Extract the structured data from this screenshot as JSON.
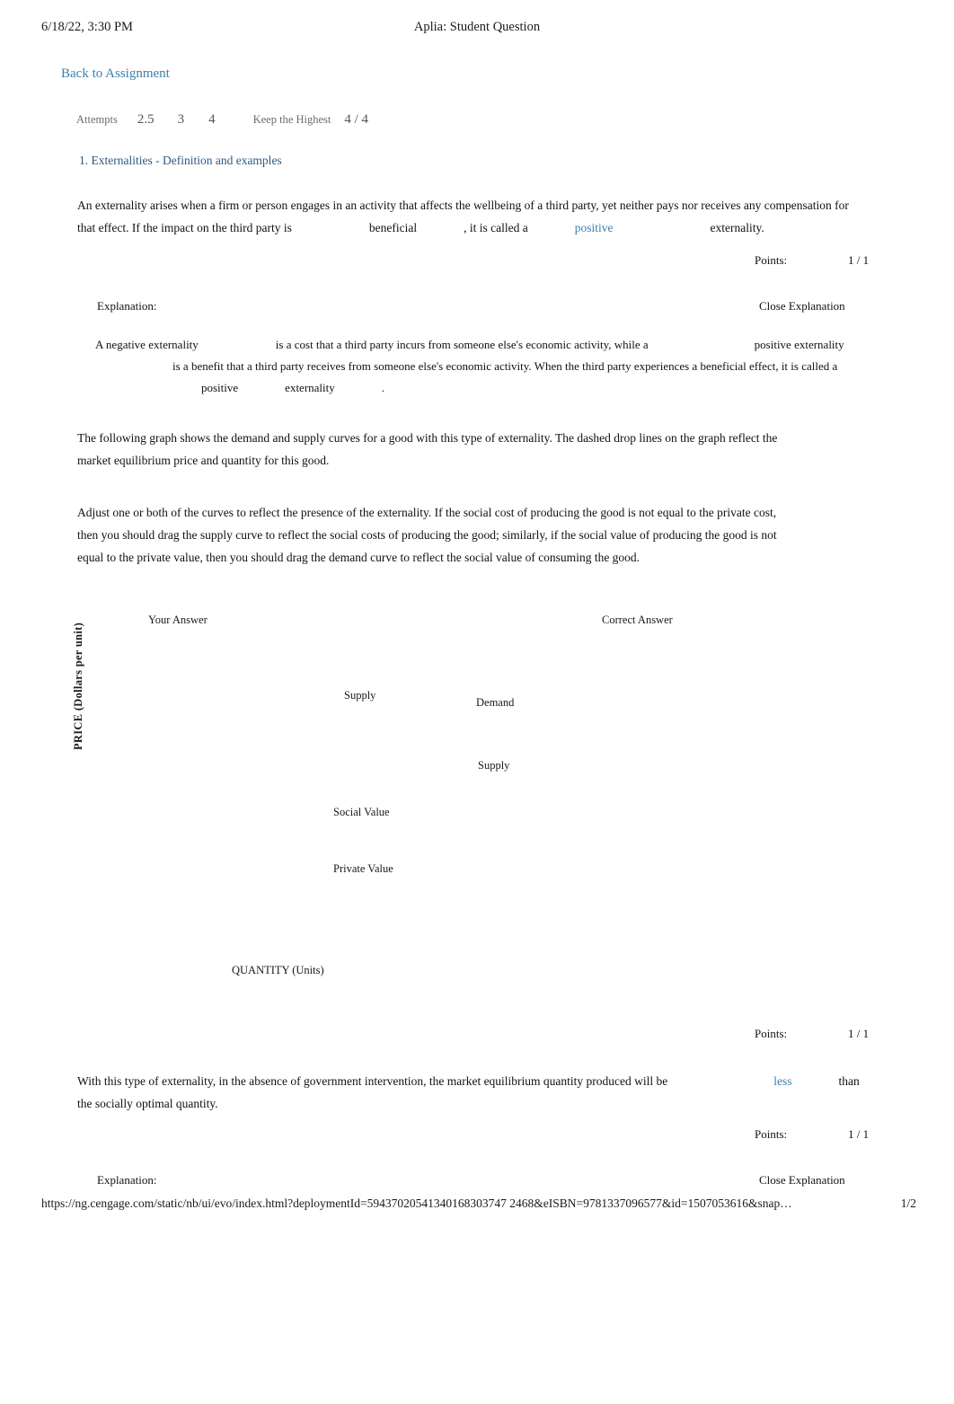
{
  "print_header": {
    "date": "6/18/22, 3:30 PM",
    "title": "Aplia: Student Question"
  },
  "print_footer": {
    "url": "https://ng.cengage.com/static/nb/ui/evo/index.html?deploymentId=59437020541340168303747 2468&eISBN=9781337096577&id=1507053616&snap…",
    "page_number": "1/2"
  },
  "nav": {
    "back_link": "Back to Assignment"
  },
  "attempts_bar": {
    "label": "Attempts",
    "values": [
      "2.5",
      "3",
      "4"
    ],
    "keep_label": "Keep the Highest",
    "keep_value": "4 / 4"
  },
  "question": {
    "title": "1. Externalities - Definition and examples",
    "prompt_part1": "An externality arises when a firm or person engages in an activity that affects the wellbeing of a third party, yet neither pays nor receives any compensation for that effect. If the impact on the third party is",
    "answer1": "beneficial",
    "prompt_part2": ", it is called a",
    "answer2": "positive",
    "prompt_part3": "externality."
  },
  "points": {
    "label": "Points:",
    "value_1": "1 / 1",
    "value_2": "1 / 1",
    "value_3": "1 / 1"
  },
  "explanation_1": {
    "heading": "Explanation:",
    "close_label": "Close Explanation",
    "lead": "A",
    "term1": "negative externality",
    "text1": "is a cost that a third party incurs from someone else's economic activity, while a",
    "term2": "positive externality",
    "text2": "is a benefit that a third party receives from someone else's economic activity. When the third party experiences a beneficial effect, it is called a",
    "term3": "positive",
    "text3": "externality",
    "text4": "."
  },
  "explanation_2": {
    "heading": "Explanation:",
    "close_label": "Close Explanation"
  },
  "graph_intro": "The following graph shows the demand and supply curves for a good with this type of externality. The dashed drop lines on the graph reflect the market equilibrium price and quantity for this good.",
  "graph_instructions": "Adjust one or both of the curves to reflect the presence of the externality. If the social cost of producing the good is not equal to the private cost, then you should drag the supply curve to reflect the social costs of producing the good; similarly, if the social value of producing the good is not equal to the private value, then you should drag the demand curve to reflect the social value of consuming the good.",
  "graph": {
    "your_answer_label": "Your Answer",
    "correct_answer_label": "Correct Answer",
    "y_axis_label": "PRICE (Dollars per unit)",
    "x_axis_label": "QUANTITY (Units)",
    "curve_labels": {
      "supply_your": "Supply",
      "demand_your": "Demand",
      "supply_correct": "Supply",
      "social_value": "Social Value",
      "private_value": "Private Value"
    }
  },
  "final_question": {
    "text_part1": "With this type of externality, in the absence of government intervention, the market equilibrium quantity produced will be",
    "answer": "less",
    "text_part2": "than the socially optimal quantity."
  }
}
